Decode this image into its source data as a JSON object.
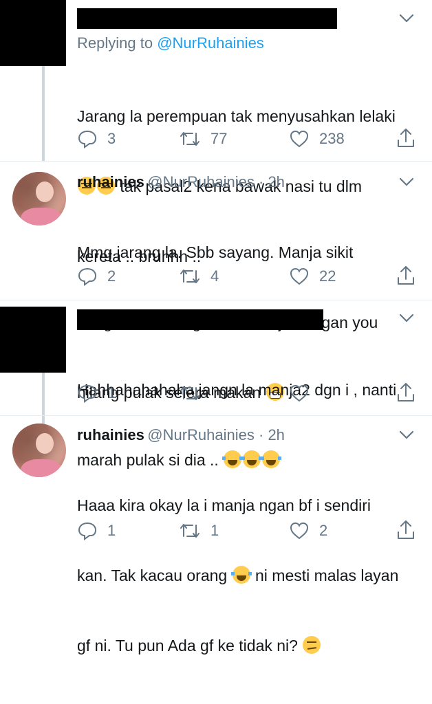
{
  "tweets": [
    {
      "reply_prefix": "Replying to ",
      "reply_handle": "@NurRuhainies",
      "text_line1": "Jarang la perempuan tak menyusahkan lelaki",
      "text_line2": " tak pasal2 kena bawak nasi tu dlm",
      "text_line3": "kereta .. bruhhh ..",
      "emoji_name": "expressionless-face-emoji",
      "replies": "3",
      "retweets": "77",
      "likes": "238"
    },
    {
      "name": "ruhainies",
      "handle_time": "@NurRuhainies · 2h",
      "text_line1": "Mmg jarang la. Sbb sayang. Manja sikit",
      "text_line2": "dengan dia. Kang kalau manja dengan you",
      "text_line3": "hilang pulak selera makan ",
      "emoji_name": "grimacing-face-emoji",
      "replies": "2",
      "retweets": "4",
      "likes": "22"
    },
    {
      "text_line1": "Hahhahahahaha jangn la manja2 dgn i , nanti",
      "text_line2": "marah pulak si dia .. ",
      "emoji_name": "tears-of-joy-emoji",
      "replies": "1",
      "retweets": "",
      "likes": ""
    },
    {
      "name": "ruhainies",
      "handle_time": "@NurRuhainies · 2h",
      "text_line1": "Haaa kira okay la i manja ngan bf i sendiri",
      "text_line2a": "kan. Tak kacau orang ",
      "text_line2b": " ni mesti malas layan",
      "text_line3": "gf ni. Tu pun Ada gf ke tidak ni? ",
      "emoji_name_1": "tears-of-joy-emoji",
      "emoji_name_2": "face-with-raised-eyebrow-emoji",
      "replies": "1",
      "retweets": "1",
      "likes": "2"
    }
  ],
  "colors": {
    "link": "#1da1f2",
    "secondary": "#657786",
    "text": "#14171a",
    "divider": "#e6ecf0",
    "thread_line": "#ccd6dd"
  },
  "icons": [
    "reply-icon",
    "retweet-icon",
    "like-icon",
    "share-icon",
    "chevron-down-icon"
  ]
}
